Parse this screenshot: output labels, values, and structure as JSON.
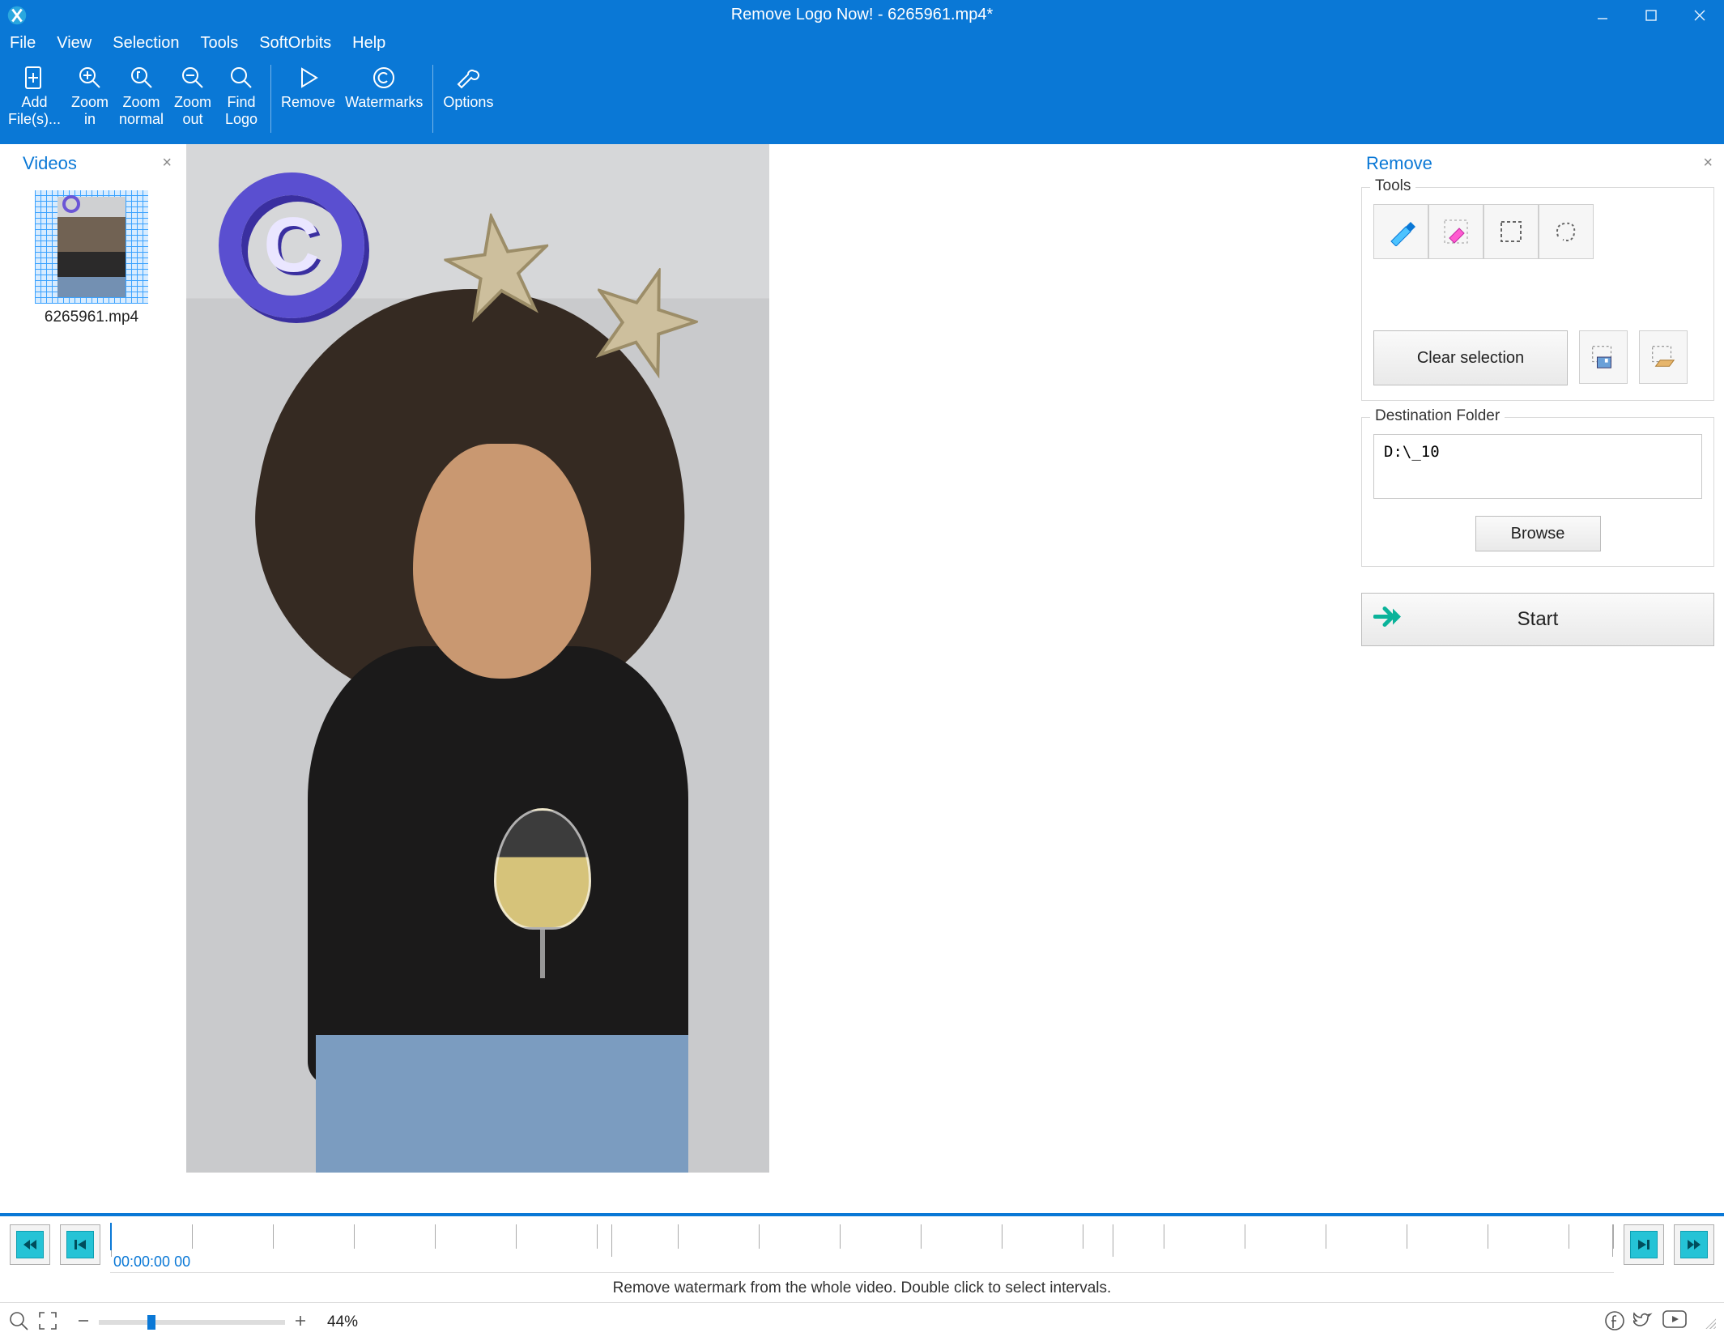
{
  "titlebar": {
    "title": "Remove Logo Now! - 6265961.mp4*"
  },
  "menu": {
    "file": "File",
    "view": "View",
    "selection": "Selection",
    "tools": "Tools",
    "softorbits": "SoftOrbits",
    "help": "Help"
  },
  "toolbar": {
    "add_l1": "Add",
    "add_l2": "File(s)...",
    "zoom_in_l1": "Zoom",
    "zoom_in_l2": "in",
    "zoom_normal_l1": "Zoom",
    "zoom_normal_l2": "normal",
    "zoom_out_l1": "Zoom",
    "zoom_out_l2": "out",
    "find_logo_l1": "Find",
    "find_logo_l2": "Logo",
    "remove": "Remove",
    "watermarks": "Watermarks",
    "options": "Options"
  },
  "videos": {
    "header": "Videos",
    "items": [
      {
        "caption": "6265961.mp4"
      }
    ]
  },
  "remove_panel": {
    "header": "Remove",
    "tools_legend": "Tools",
    "clear_selection": "Clear selection",
    "dest_legend": "Destination Folder",
    "dest_value": "D:\\_10",
    "browse": "Browse",
    "start": "Start"
  },
  "timeline": {
    "timecode": "00:00:00 00",
    "message": "Remove watermark from the whole video. Double click to select intervals."
  },
  "status": {
    "zoom_pct": "44%"
  }
}
